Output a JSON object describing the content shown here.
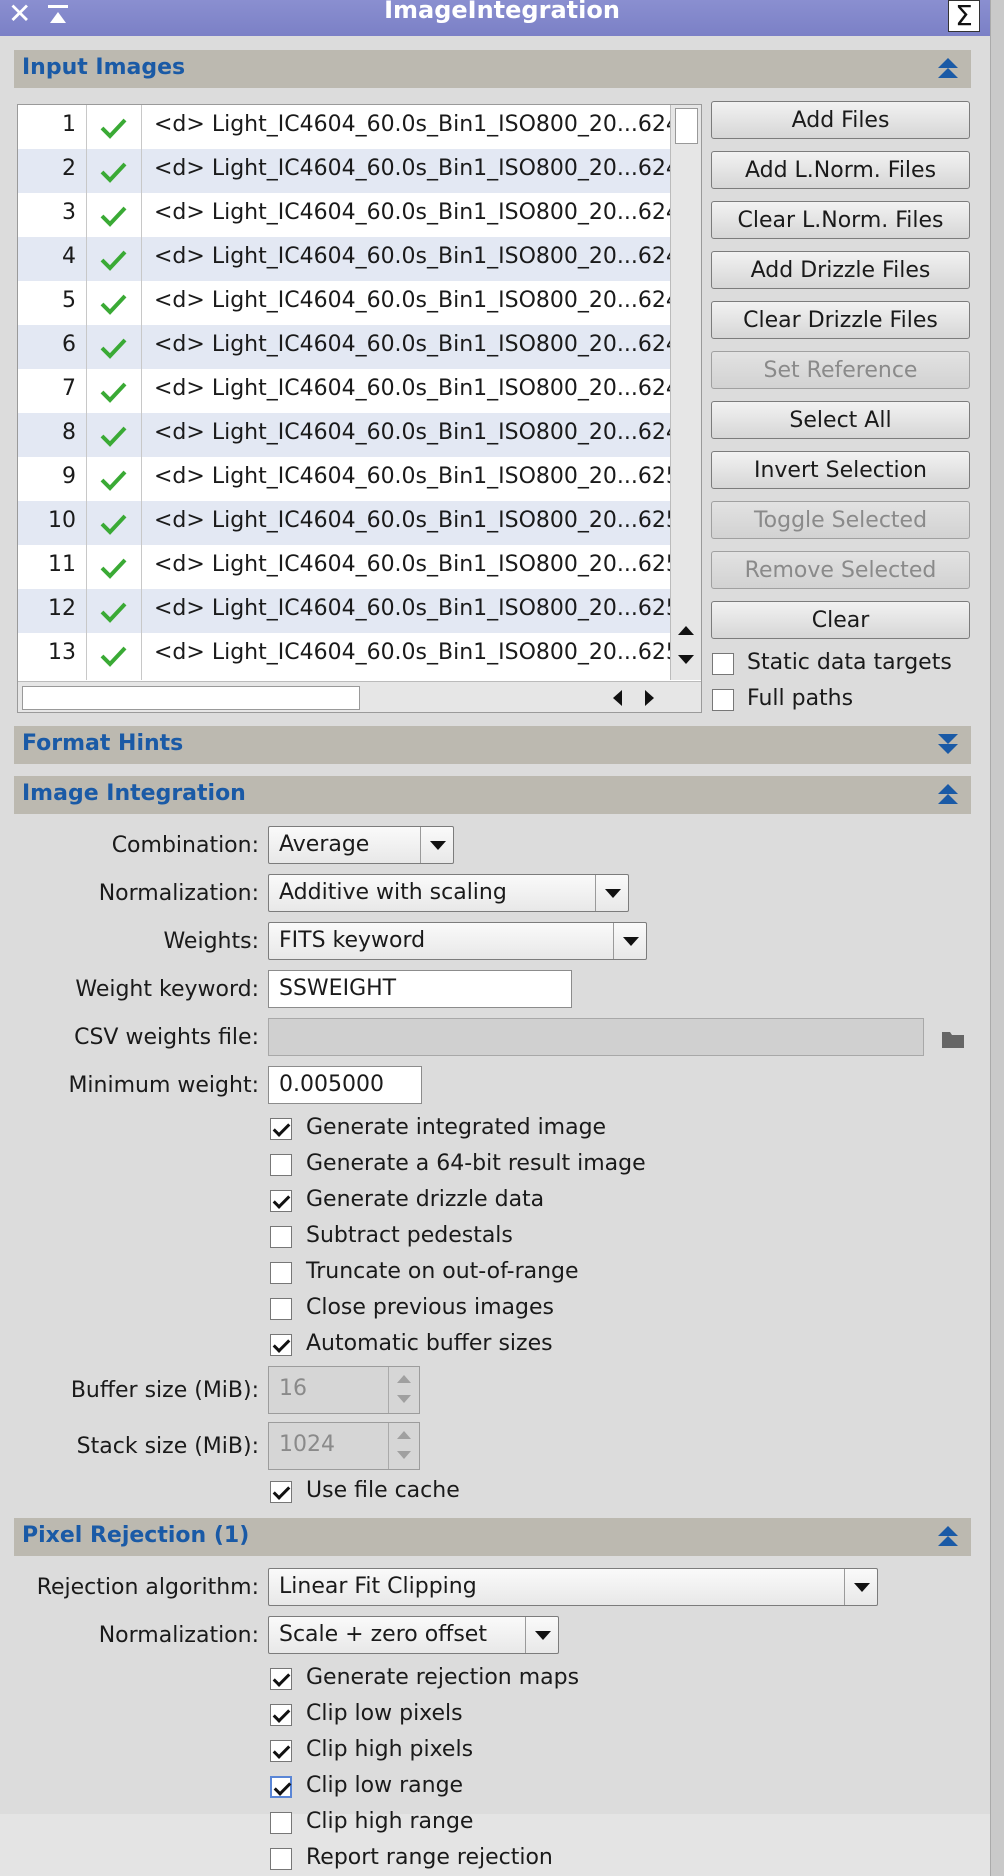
{
  "window": {
    "title": "ImageIntegration",
    "sigma_label": "Σ"
  },
  "sections": {
    "input_images": "Input Images",
    "format_hints": "Format Hints",
    "image_integration": "Image Integration",
    "pixel_rejection": "Pixel Rejection (1)"
  },
  "files": [
    {
      "num": "1",
      "name": "<d> Light_IC4604_60.0s_Bin1_ISO800_20...624"
    },
    {
      "num": "2",
      "name": "<d> Light_IC4604_60.0s_Bin1_ISO800_20...624"
    },
    {
      "num": "3",
      "name": "<d> Light_IC4604_60.0s_Bin1_ISO800_20...624"
    },
    {
      "num": "4",
      "name": "<d> Light_IC4604_60.0s_Bin1_ISO800_20...624"
    },
    {
      "num": "5",
      "name": "<d> Light_IC4604_60.0s_Bin1_ISO800_20...624"
    },
    {
      "num": "6",
      "name": "<d> Light_IC4604_60.0s_Bin1_ISO800_20...624"
    },
    {
      "num": "7",
      "name": "<d> Light_IC4604_60.0s_Bin1_ISO800_20...624"
    },
    {
      "num": "8",
      "name": "<d> Light_IC4604_60.0s_Bin1_ISO800_20...624"
    },
    {
      "num": "9",
      "name": "<d> Light_IC4604_60.0s_Bin1_ISO800_20...625"
    },
    {
      "num": "10",
      "name": "<d> Light_IC4604_60.0s_Bin1_ISO800_20...625"
    },
    {
      "num": "11",
      "name": "<d> Light_IC4604_60.0s_Bin1_ISO800_20...625"
    },
    {
      "num": "12",
      "name": "<d> Light_IC4604_60.0s_Bin1_ISO800_20...625"
    },
    {
      "num": "13",
      "name": "<d> Light_IC4604_60.0s_Bin1_ISO800_20...625"
    }
  ],
  "buttons": {
    "add_files": "Add Files",
    "add_lnorm": "Add L.Norm. Files",
    "clear_lnorm": "Clear L.Norm. Files",
    "add_drizzle": "Add Drizzle Files",
    "clear_drizzle": "Clear Drizzle Files",
    "set_reference": "Set Reference",
    "select_all": "Select All",
    "invert_selection": "Invert Selection",
    "toggle_selected": "Toggle Selected",
    "remove_selected": "Remove Selected",
    "clear": "Clear"
  },
  "input_options": {
    "static_targets": {
      "label": "Static data targets",
      "checked": false
    },
    "full_paths": {
      "label": "Full paths",
      "checked": false
    }
  },
  "integration": {
    "combination": {
      "label": "Combination:",
      "value": "Average"
    },
    "normalization": {
      "label": "Normalization:",
      "value": "Additive with scaling"
    },
    "weights": {
      "label": "Weights:",
      "value": "FITS keyword"
    },
    "weight_keyword": {
      "label": "Weight keyword:",
      "value": "SSWEIGHT"
    },
    "csv_weights": {
      "label": "CSV weights file:",
      "value": ""
    },
    "min_weight": {
      "label": "Minimum weight:",
      "value": "0.005000"
    },
    "checks": [
      {
        "label": "Generate integrated image",
        "checked": true
      },
      {
        "label": "Generate a 64-bit result image",
        "checked": false
      },
      {
        "label": "Generate drizzle data",
        "checked": true
      },
      {
        "label": "Subtract pedestals",
        "checked": false
      },
      {
        "label": "Truncate on out-of-range",
        "checked": false
      },
      {
        "label": "Close previous images",
        "checked": false
      },
      {
        "label": "Automatic buffer sizes",
        "checked": true
      }
    ],
    "buffer_size": {
      "label": "Buffer size (MiB):",
      "value": "16"
    },
    "stack_size": {
      "label": "Stack size (MiB):",
      "value": "1024"
    },
    "file_cache": {
      "label": "Use file cache",
      "checked": true
    }
  },
  "rejection": {
    "algorithm": {
      "label": "Rejection algorithm:",
      "value": "Linear Fit Clipping"
    },
    "normalization": {
      "label": "Normalization:",
      "value": "Scale + zero offset"
    },
    "checks": [
      {
        "label": "Generate rejection maps",
        "checked": true
      },
      {
        "label": "Clip low pixels",
        "checked": true
      },
      {
        "label": "Clip high pixels",
        "checked": true
      },
      {
        "label": "Clip low range",
        "checked": true
      },
      {
        "label": "Clip high range",
        "checked": false
      },
      {
        "label": "Report range rejection",
        "checked": false
      }
    ]
  },
  "colors": {
    "accent": "#1a5aa6",
    "check_green": "#3aaa35",
    "titlebar": "#7b80c6"
  }
}
